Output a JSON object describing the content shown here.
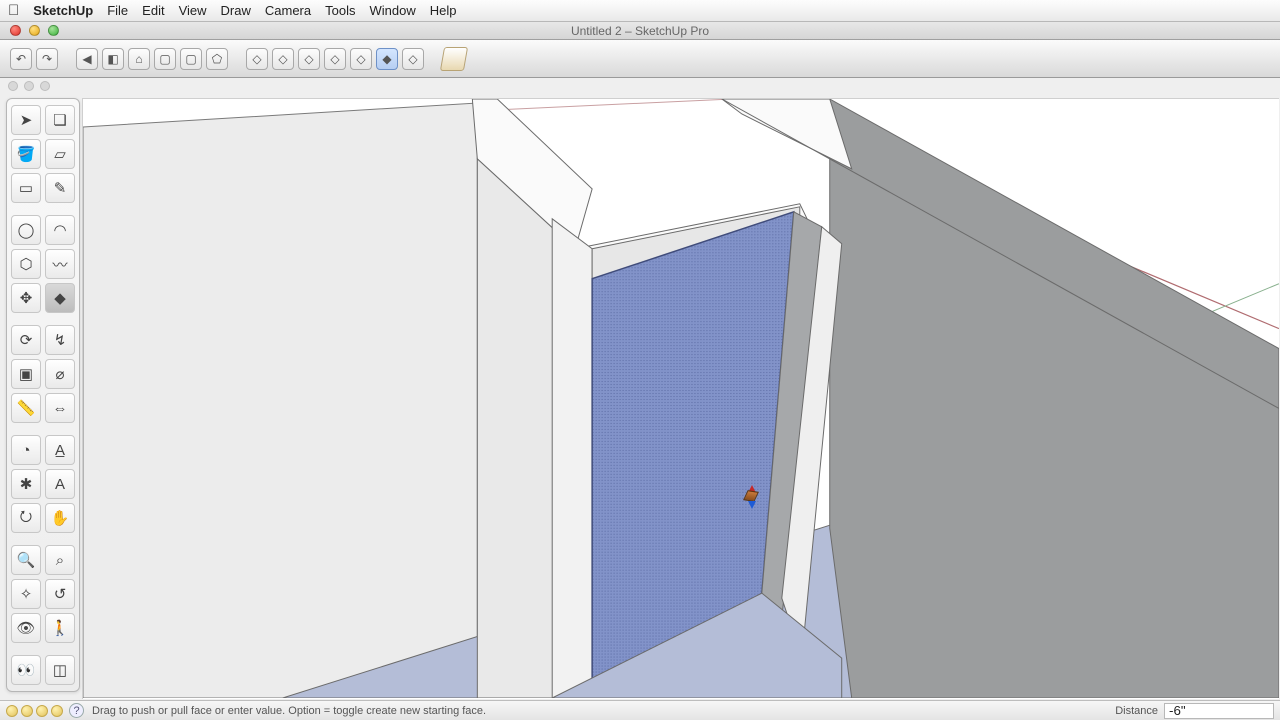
{
  "os_menu": {
    "app_name": "SketchUp",
    "items": [
      "File",
      "Edit",
      "View",
      "Draw",
      "Camera",
      "Tools",
      "Window",
      "Help"
    ]
  },
  "window": {
    "title": "Untitled 2 – SketchUp Pro"
  },
  "toolbar": {
    "groups": [
      {
        "id": "undo",
        "buttons": [
          {
            "name": "undo-button",
            "icon": "undo"
          },
          {
            "name": "redo-button",
            "icon": "redo"
          }
        ]
      },
      {
        "id": "camera-std",
        "buttons": [
          {
            "name": "prev-view-button",
            "icon": "arrow-left"
          },
          {
            "name": "iso-view-button",
            "icon": "cube"
          },
          {
            "name": "top-view-button",
            "icon": "house"
          },
          {
            "name": "front-view-button",
            "icon": "square"
          },
          {
            "name": "right-view-button",
            "icon": "square"
          },
          {
            "name": "back-view-button",
            "icon": "pentagon"
          }
        ]
      },
      {
        "id": "face-style",
        "buttons": [
          {
            "name": "wireframe-button",
            "icon": "diamond"
          },
          {
            "name": "hidden-line-button",
            "icon": "diamond"
          },
          {
            "name": "shaded-button",
            "icon": "diamond"
          },
          {
            "name": "shaded-tex-button",
            "icon": "diamond-open"
          },
          {
            "name": "xray-button",
            "icon": "diamond"
          },
          {
            "name": "monochrome-button",
            "icon": "diamond-filled",
            "active": true
          },
          {
            "name": "back-edges-button",
            "icon": "diamond"
          }
        ]
      },
      {
        "id": "misc",
        "buttons": [
          {
            "name": "warehouse-button",
            "icon": "box3d"
          }
        ]
      }
    ]
  },
  "palette": {
    "rows": [
      [
        {
          "name": "select-tool",
          "icon": "cursor"
        },
        {
          "name": "make-component-tool",
          "icon": "component"
        }
      ],
      [
        {
          "name": "paint-bucket-tool",
          "icon": "bucket"
        },
        {
          "name": "eraser-tool",
          "icon": "eraser"
        }
      ],
      [
        {
          "name": "rectangle-tool",
          "icon": "rect"
        },
        {
          "name": "line-tool",
          "icon": "pencil"
        }
      ],
      [
        {
          "name": "circle-tool",
          "icon": "circle"
        },
        {
          "name": "arc-tool",
          "icon": "arc"
        }
      ],
      [
        {
          "name": "polygon-tool",
          "icon": "polygon"
        },
        {
          "name": "freehand-tool",
          "icon": "freehand"
        }
      ],
      [
        {
          "name": "move-tool",
          "icon": "move"
        },
        {
          "name": "pushpull-tool",
          "icon": "pushpull"
        }
      ],
      [
        {
          "name": "rotate-tool",
          "icon": "rotate"
        },
        {
          "name": "followme-tool",
          "icon": "followme"
        }
      ],
      [
        {
          "name": "scale-tool",
          "icon": "scale"
        },
        {
          "name": "offset-tool",
          "icon": "offset"
        }
      ],
      [
        {
          "name": "tape-tool",
          "icon": "tape"
        },
        {
          "name": "dimension-tool",
          "icon": "dim"
        }
      ],
      [
        {
          "name": "protractor-tool",
          "icon": "protractor"
        },
        {
          "name": "text-tool",
          "icon": "text"
        }
      ],
      [
        {
          "name": "axes-tool",
          "icon": "axes"
        },
        {
          "name": "3dtext-tool",
          "icon": "3dtext"
        }
      ],
      [
        {
          "name": "orbit-tool",
          "icon": "orbit"
        },
        {
          "name": "pan-tool",
          "icon": "pan"
        }
      ],
      [
        {
          "name": "zoom-tool",
          "icon": "zoom"
        },
        {
          "name": "zoom-window-tool",
          "icon": "zoomwin"
        }
      ],
      [
        {
          "name": "zoom-extents-tool",
          "icon": "zoomext"
        },
        {
          "name": "previous-tool",
          "icon": "prev"
        }
      ],
      [
        {
          "name": "position-camera-tool",
          "icon": "poscam"
        },
        {
          "name": "walk-tool",
          "icon": "walk"
        }
      ],
      [
        {
          "name": "lookaround-tool",
          "icon": "look"
        },
        {
          "name": "section-tool",
          "icon": "section"
        }
      ]
    ]
  },
  "status": {
    "hint": "Drag to push or pull face or enter value.  Option = toggle create new starting face.",
    "measure_label": "Distance",
    "measure_value": "-6\""
  },
  "scene": {
    "floor_color": "#b4bdd7",
    "wall_light": "#f0f0f0",
    "wall_shadow": "#9a9c9d",
    "selected_face_color": "#7a8cc7",
    "axis_colors": {
      "x_neg": "#b0787a",
      "y_neg": "#7da887"
    }
  },
  "icons": {
    "undo": "↶",
    "redo": "↷",
    "arrow-left": "◀",
    "cube": "◧",
    "house": "⌂",
    "square": "▢",
    "pentagon": "⬠",
    "diamond": "◇",
    "diamond-open": "◇",
    "diamond-filled": "◆",
    "box3d": "",
    "cursor": "➤",
    "component": "❏",
    "bucket": "🪣",
    "eraser": "▱",
    "rect": "▭",
    "pencil": "✎",
    "circle": "◯",
    "arc": "◠",
    "polygon": "⬡",
    "freehand": "〰",
    "move": "✥",
    "pushpull": "◆",
    "rotate": "⟳",
    "followme": "↯",
    "scale": "▣",
    "offset": "⌀",
    "tape": "📏",
    "dim": "⇔",
    "protractor": "◔",
    "text": "A̲",
    "axes": "✱",
    "3dtext": "A",
    "orbit": "⭮",
    "pan": "✋",
    "zoom": "🔍",
    "zoomwin": "⌕",
    "zoomext": "✧",
    "prev": "↺",
    "poscam": "👁",
    "walk": "🚶",
    "look": "👀",
    "section": "◫"
  }
}
